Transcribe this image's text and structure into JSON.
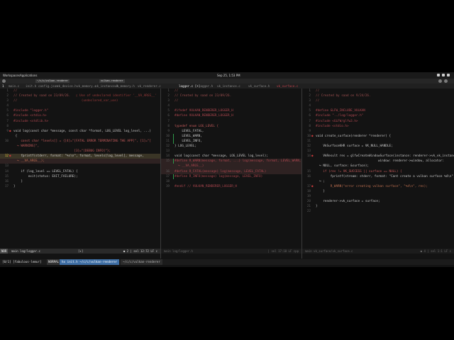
{
  "gnome": {
    "activities": "Workspaces",
    "apps": "Applications",
    "title": "fabulous-lemur : ~/c/c/vulkan-renderer",
    "clock": "Sep 25, 1:53 PM"
  },
  "terminal": {
    "tabs": [
      "~/c/c/vulkan-renderer",
      "vulkan-renderer"
    ]
  },
  "tabline": {
    "items": [
      {
        "label": "1",
        "kind": "cur"
      },
      {
        "label": "main.c",
        "kind": "oth"
      },
      {
        "label": "init.h",
        "kind": "oth"
      },
      {
        "label": "config.json",
        "kind": "oth"
      },
      {
        "label": "vk_device.h",
        "kind": "oth"
      },
      {
        "label": "vk_memory.c",
        "kind": "oth"
      },
      {
        "label": "vk_instance.h",
        "kind": "oth"
      },
      {
        "label": "vk_memory.h",
        "kind": "oth"
      },
      {
        "label": "vk_renderer.c",
        "kind": "oth"
      },
      {
        "label": "logger.c [+]",
        "kind": "cur"
      },
      {
        "label": "logger.h",
        "kind": "oth"
      },
      {
        "label": "vk_instance.c",
        "kind": "oth"
      },
      {
        "label": "vk_surface.h",
        "kind": "oth"
      },
      {
        "label": "vk_surface.c",
        "kind": "red"
      }
    ]
  },
  "panes": [
    {
      "name": "logger-c",
      "lines": [
        {
          "n": "1",
          "t": "//",
          "c": "c-comment"
        },
        {
          "n": "2",
          "t": "// Created by saad on 23/09/26.",
          "c": "c-comment",
          "diag": "   ▯ Use of undeclared identifier '__VA_ARGS__'"
        },
        {
          "n": "3",
          "t": "//",
          "c": "c-comment",
          "diag": "                                   (undeclared_var_use)"
        },
        {
          "n": "4",
          "t": "",
          "c": "c-plain"
        },
        {
          "n": "5",
          "t": "#include \"logger.h\"",
          "c": "c-macro"
        },
        {
          "n": "6",
          "t": "#include <stdio.h>",
          "c": "c-macro"
        },
        {
          "n": "7",
          "t": "#include <stdlib.h>",
          "c": "c-macro"
        },
        {
          "n": "8",
          "t": "",
          "c": "c-plain"
        },
        {
          "n": "9",
          "t": "void log(const char *message, const char *format, LOG_LEVEL log_level, ...)",
          "c": "c-plain",
          "sign": "E"
        },
        {
          "n": "",
          "t": " {",
          "c": "c-plain"
        },
        {
          "n": "10",
          "t": "    const char *levels[] = {[4]=\"[FATAL ERROR TERMINATING THE APP]\", [1]=\"[",
          "c": "c-kw"
        },
        {
          "n": "",
          "t": "  ↪ WARNING]\",",
          "c": "c-kw"
        },
        {
          "n": "",
          "t": "                                 [3]=\"[DEBUG INFO]\"};",
          "c": "c-kw"
        },
        {
          "n": "12",
          "t": "    fprintf(stderr, format: \"%s\\n\", format, levels[log_level], message,",
          "c": "c-plain",
          "cur": true,
          "sign": "E"
        },
        {
          "n": "",
          "t": "  ↪ __VA_ARGS__);",
          "c": "c-warn",
          "hl": "red"
        },
        {
          "n": "13",
          "t": "",
          "c": "c-plain"
        },
        {
          "n": "14",
          "t": "    if (log_level == LEVEL_FATAL) {",
          "c": "c-plain"
        },
        {
          "n": "15",
          "t": "        exit(status: EXIT_FAILURE);",
          "c": "c-plain"
        },
        {
          "n": "16",
          "t": "    }",
          "c": "c-plain"
        },
        {
          "n": "17",
          "t": "}",
          "c": "c-plain"
        }
      ],
      "status": {
        "mode": "NOR",
        "left": "main  log/logger.c",
        "mid": "[+]",
        "right": "● 2   | sel   12:72   LF   c"
      }
    },
    {
      "name": "logger-h",
      "lines": [
        {
          "n": "1",
          "t": "//",
          "c": "c-comment"
        },
        {
          "n": "2",
          "t": "// Created by saad on 23/09/26.",
          "c": "c-comment"
        },
        {
          "n": "3",
          "t": "//",
          "c": "c-comment"
        },
        {
          "n": "4",
          "t": "",
          "c": "c-plain"
        },
        {
          "n": "5",
          "t": "#ifndef VULKAN_RENDERER_LOGGER_H",
          "c": "c-macro"
        },
        {
          "n": "6",
          "t": "#define VULKAN_RENDERER_LOGGER_H",
          "c": "c-macro"
        },
        {
          "n": "7",
          "t": "",
          "c": "c-plain"
        },
        {
          "n": "8",
          "t": "typedef enum LOG_LEVEL {",
          "c": "c-kw"
        },
        {
          "n": "9",
          "t": "    LEVEL_FATAL,",
          "c": "c-plain"
        },
        {
          "n": "10",
          "t": "    LEVEL_WARN,",
          "c": "c-plain",
          "git": true
        },
        {
          "n": "11",
          "t": "    LEVEL_INFO,",
          "c": "c-plain",
          "git": true
        },
        {
          "n": "12",
          "t": "} LOG_LEVEL;",
          "c": "c-plain"
        },
        {
          "n": "13",
          "t": "",
          "c": "c-plain"
        },
        {
          "n": "14",
          "t": "void log(const char *message, LOG_LEVEL log_level);",
          "c": "c-plain"
        },
        {
          "n": "15",
          "t": "#define R_WARN(message, format, ...) log(message, format, LEVEL_WARN,",
          "c": "c-macro",
          "hl": "red",
          "git": true
        },
        {
          "n": "",
          "t": "  ↪ __VA_ARGS__)",
          "c": "c-macro",
          "hl": "red"
        },
        {
          "n": "16",
          "t": "#define R_FATAL(message) log(message, LEVEL_FATAL)",
          "c": "c-macro",
          "hl": "red"
        },
        {
          "n": "17",
          "t": "#define R_INFO(message) log(message, LEVEL_INFO)",
          "c": "c-macro",
          "git": true
        },
        {
          "n": "18",
          "t": "",
          "c": "c-plain"
        },
        {
          "n": "19",
          "t": "#endif // VULKAN_RENDERER_LOGGER_H",
          "c": "c-macro"
        }
      ],
      "status": {
        "mode": "",
        "left": "main  log/logger.h",
        "mid": "",
        "right": "| sel   17:18   LF   cpp"
      }
    },
    {
      "name": "vk-surface-c",
      "lines": [
        {
          "n": "1",
          "t": "//",
          "c": "c-comment"
        },
        {
          "n": "2",
          "t": "// Created by saad on 9/24/26.",
          "c": "c-comment"
        },
        {
          "n": "3",
          "t": "//",
          "c": "c-comment"
        },
        {
          "n": "4",
          "t": "",
          "c": "c-plain"
        },
        {
          "n": "5",
          "t": "#define GLFW_INCLUDE_VULKAN",
          "c": "c-macro"
        },
        {
          "n": "6",
          "t": "#include \"../log/logger.h\"",
          "c": "c-macro"
        },
        {
          "n": "7",
          "t": "#include <GLFW/glfw3.h>",
          "c": "c-macro"
        },
        {
          "n": "8",
          "t": "#include <stdio.h>",
          "c": "c-macro"
        },
        {
          "n": "9",
          "t": "",
          "c": "c-plain"
        },
        {
          "n": "10",
          "t": "void create_surface(renderer *renderer) {",
          "c": "c-plain",
          "sign": "E"
        },
        {
          "n": "11",
          "t": "",
          "c": "c-plain"
        },
        {
          "n": "12",
          "t": "    VkSurfaceKHR surface = VK_NULL_HANDLE;",
          "c": "c-plain"
        },
        {
          "n": "13",
          "t": "",
          "c": "c-plain"
        },
        {
          "n": "14",
          "t": "    VkResult res = glfwCreateWindowSurface(instance: renderer->vk_vk_instance,",
          "c": "c-plain",
          "sign": "E"
        },
        {
          "n": "",
          "t": "                                  window: renderer->window, allocator:",
          "c": "c-plain"
        },
        {
          "n": "",
          "t": "  ↪ NULL, surface: &surface);",
          "c": "c-plain"
        },
        {
          "n": "15",
          "t": "    if (res != VK_SUCCESS || surface == NULL) {",
          "c": "c-kw"
        },
        {
          "n": "16",
          "t": "        fprintf(stream: stderr, format: \"Cant create a vulkan surface %d\\n\", res);",
          "c": "c-plain"
        },
        {
          "n": "",
          "t": "  ↪ ;",
          "c": "c-plain"
        },
        {
          "n": "17",
          "t": "        R_WARN(\"error creating vulkan surface\", \"%d\\n\", res);",
          "c": "c-warn",
          "sign": "E"
        },
        {
          "n": "18",
          "t": "    }",
          "c": "c-plain"
        },
        {
          "n": "19",
          "t": "",
          "c": "c-plain"
        },
        {
          "n": "20",
          "t": "    renderer->vk_surface = surface;",
          "c": "c-plain"
        },
        {
          "n": "21",
          "t": "}",
          "c": "c-plain"
        },
        {
          "n": "22",
          "t": "",
          "c": "c-plain"
        }
      ],
      "status": {
        "mode": "",
        "left": "main  vk_surface/vk_surface.c",
        "mid": "",
        "right": "● 4   | sel   1:1   LF   c"
      }
    }
  ],
  "tmux": {
    "session": "[0/1] [fabulous-lemur]",
    "mode": "NORMAL",
    "windows": [
      {
        "label": "hx init.h  ~/c/c/vulkan-renderer",
        "current": true
      },
      {
        "label": "~/c/c/vulkan-renderer",
        "current": false
      }
    ]
  },
  "colors": {
    "accent": "#3e6ea4",
    "error": "#c23a3a",
    "git_add": "#2f9a4a"
  }
}
